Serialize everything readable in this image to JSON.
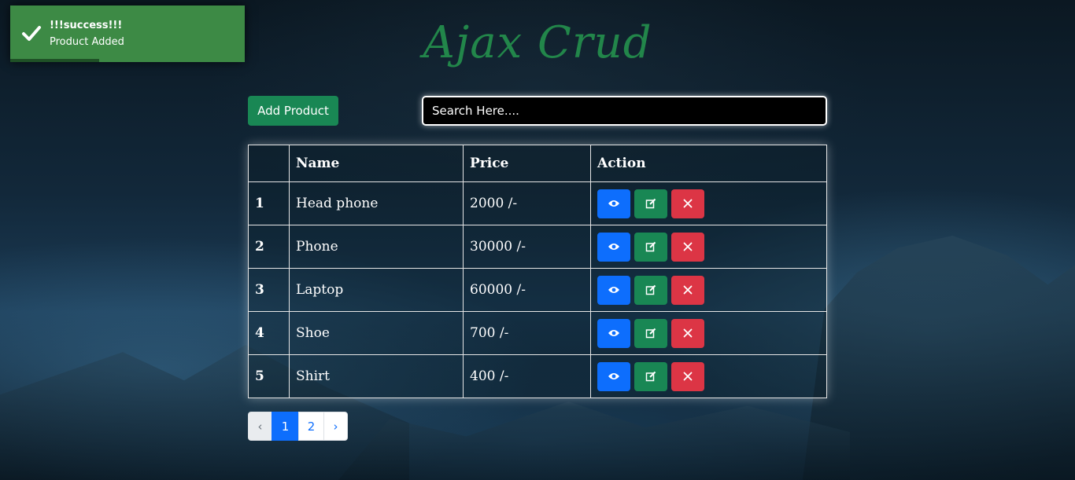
{
  "toast": {
    "title": "!!!success!!!",
    "message": "Product Added",
    "icon": "check-icon",
    "color": "#3d8a45",
    "progress_percent": 38
  },
  "header": {
    "title": "Ajax Crud",
    "title_color": "#22864a"
  },
  "toolbar": {
    "add_label": "Add Product",
    "search_placeholder": "Search Here...."
  },
  "table": {
    "columns": [
      "",
      "Name",
      "Price",
      "Action"
    ],
    "rows": [
      {
        "id": "1",
        "name": "Head phone",
        "price": "2000 /-"
      },
      {
        "id": "2",
        "name": "Phone",
        "price": "30000 /-"
      },
      {
        "id": "3",
        "name": "Laptop",
        "price": "60000 /-"
      },
      {
        "id": "4",
        "name": "Shoe",
        "price": "700 /-"
      },
      {
        "id": "5",
        "name": "Shirt",
        "price": "400 /-"
      }
    ],
    "action_icons": [
      "eye-icon",
      "edit-icon",
      "close-icon"
    ],
    "action_colors": {
      "view": "#0d6efd",
      "edit": "#198754",
      "delete": "#dc3545"
    }
  },
  "pagination": {
    "prev": "‹",
    "pages": [
      "1",
      "2"
    ],
    "active": "1",
    "next": "›"
  }
}
